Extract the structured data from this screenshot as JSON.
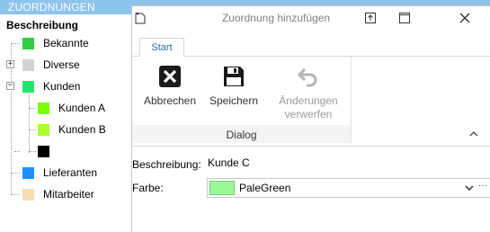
{
  "background": {
    "header_title": "ZUORDNUNGEN",
    "tree_root": "Beschreibung",
    "nodes": [
      {
        "label": "Bekannte",
        "color": "#2ecc40"
      },
      {
        "label": "Diverse",
        "color": "#d3d3d3"
      },
      {
        "label": "Kunden",
        "color": "#1ee86a"
      },
      {
        "label": "Kunden A",
        "color": "#7cfc00"
      },
      {
        "label": "Kunden B",
        "color": "#adff2f"
      },
      {
        "label": "",
        "color": "#000000"
      },
      {
        "label": "Lieferanten",
        "color": "#1e90ff"
      },
      {
        "label": "Mitarbeiter",
        "color": "#f5deb3"
      }
    ],
    "expanders": {
      "diverse": "+",
      "kunden": "−"
    }
  },
  "dialog": {
    "title": "Zuordnung hinzufügen",
    "tab_start": "Start",
    "ribbon": {
      "cancel_label": "Abbrechen",
      "save_label": "Speichern",
      "discard_label_1": "Änderungen",
      "discard_label_2": "verwerfen",
      "group_label": "Dialog"
    },
    "form": {
      "description_label": "Beschreibung:",
      "description_value": "Kunde C",
      "color_label": "Farbe:",
      "color_value": "PaleGreen",
      "color_hex": "#98fb98",
      "more_button": "···"
    }
  }
}
